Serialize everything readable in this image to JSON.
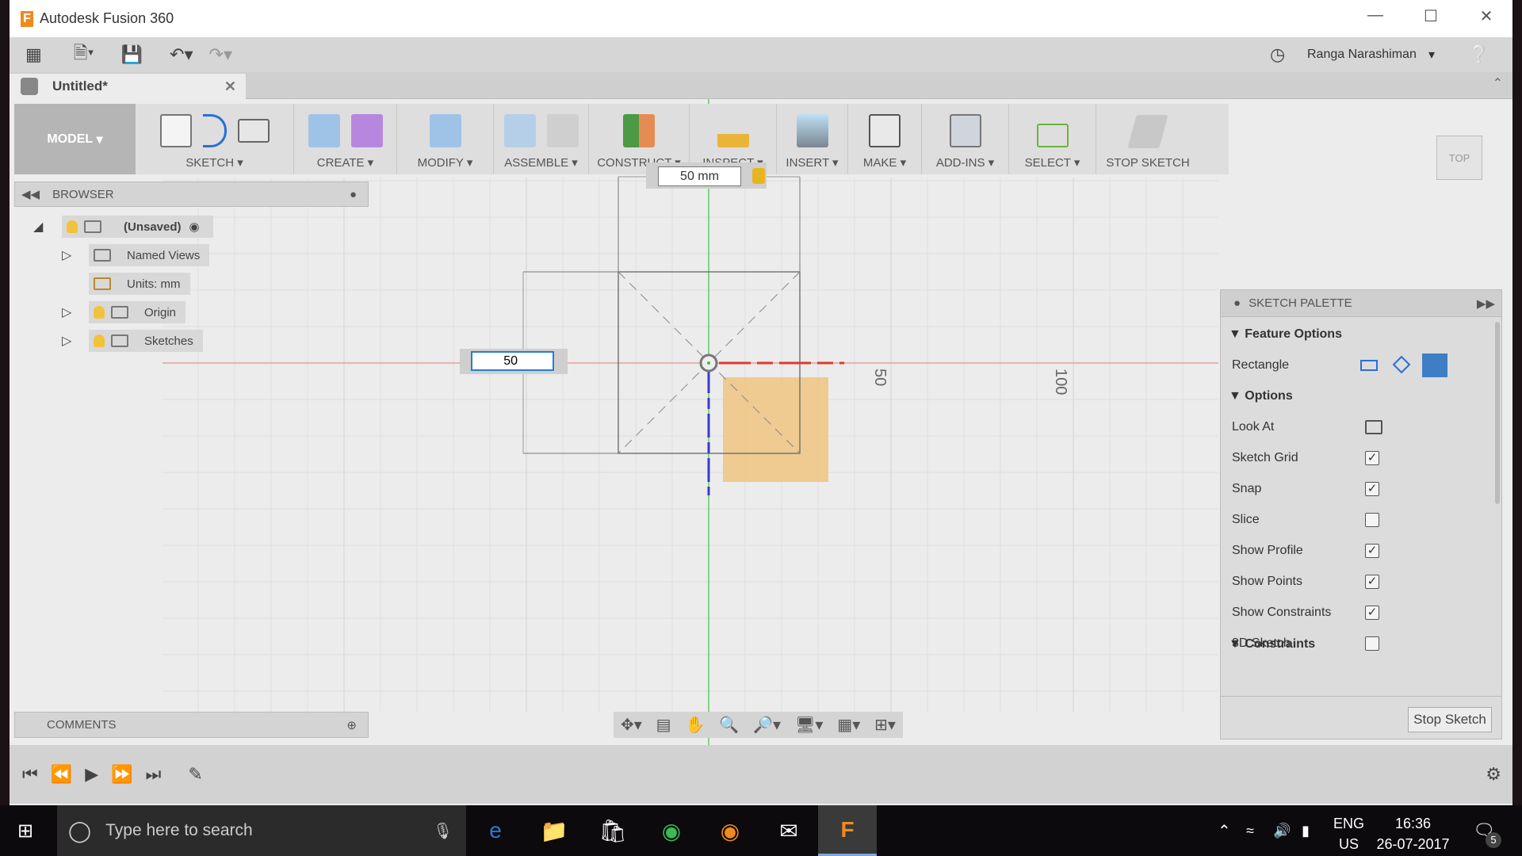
{
  "window": {
    "title": "Autodesk Fusion 360",
    "user": "Ranga Narashiman",
    "doc_tab": "Untitled*"
  },
  "ribbon": {
    "workspace": "MODEL",
    "groups": [
      "SKETCH",
      "CREATE",
      "MODIFY",
      "ASSEMBLE",
      "CONSTRUCT",
      "INSPECT",
      "INSERT",
      "MAKE",
      "ADD-INS",
      "SELECT",
      "STOP SKETCH"
    ]
  },
  "browser": {
    "title": "BROWSER",
    "root": "(Unsaved)",
    "items": [
      "Named Views",
      "Units: mm",
      "Origin",
      "Sketches"
    ]
  },
  "comments": {
    "title": "COMMENTS"
  },
  "canvas": {
    "dim_horizontal": "50 mm",
    "dim_vertical_input": "50",
    "axis_labels": [
      "50",
      "100"
    ]
  },
  "viewcube": {
    "face": "TOP"
  },
  "palette": {
    "title": "SKETCH PALETTE",
    "feature_options": "Feature Options",
    "rectangle": "Rectangle",
    "options_heading": "Options",
    "look_at": "Look At",
    "options": [
      {
        "label": "Sketch Grid",
        "checked": true
      },
      {
        "label": "Snap",
        "checked": true
      },
      {
        "label": "Slice",
        "checked": false
      },
      {
        "label": "Show Profile",
        "checked": true
      },
      {
        "label": "Show Points",
        "checked": true
      },
      {
        "label": "Show Constraints",
        "checked": true
      },
      {
        "label": "3D Sketch",
        "checked": false
      }
    ],
    "constraints": "Constraints",
    "stop_sketch": "Stop Sketch"
  },
  "taskbar": {
    "search_placeholder": "Type here to search",
    "lang1": "ENG",
    "lang2": "US",
    "time": "16:36",
    "date": "26-07-2017",
    "notifications": "5"
  },
  "colors": {
    "x_axis": "#e03a2e",
    "y_axis": "#3cc43c",
    "accent": "#f08a1c",
    "profile": "#f0c27a"
  }
}
